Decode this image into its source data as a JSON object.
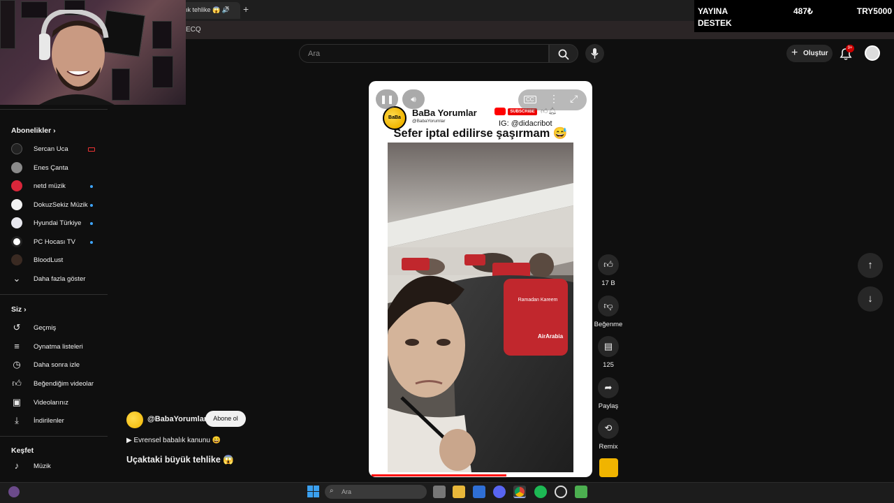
{
  "browser": {
    "tab_title": "ık tehlike 😱 🔊",
    "tab_close": "×",
    "new_tab": "+",
    "url_fragment": "ECQ"
  },
  "donation": {
    "line1": "YAYINA",
    "line2": "DESTEK",
    "amount": "487₺",
    "currency": "TRY5000"
  },
  "header": {
    "search_placeholder": "Ara",
    "create_label": "Oluştur",
    "notification_count": "9+"
  },
  "sidebar": {
    "subscriptions_title": "Abonelikler",
    "subscriptions": [
      {
        "label": "Sercan Uca"
      },
      {
        "label": "Enes Çanta"
      },
      {
        "label": "netd müzik"
      },
      {
        "label": "DokuzSekiz Müzik"
      },
      {
        "label": "Hyundai Türkiye"
      },
      {
        "label": "PC Hocası TV"
      },
      {
        "label": "BloodLust"
      }
    ],
    "show_more": "Daha fazla göster",
    "you_title": "Siz",
    "you_items": [
      {
        "label": "Geçmiş"
      },
      {
        "label": "Oynatma listeleri"
      },
      {
        "label": "Daha sonra izle"
      },
      {
        "label": "Beğendiğim videolar"
      },
      {
        "label": "Videolarınız"
      },
      {
        "label": "İndirilenler"
      }
    ],
    "explore_title": "Keşfet",
    "explore_items": [
      {
        "label": "Müzik"
      }
    ]
  },
  "short": {
    "channel_name": "BaBa Yorumlar",
    "channel_handle_small": "@BabaYorumlar",
    "subscribe_tag": "SUBSCRIBE",
    "instagram": "IG: @didacribot",
    "overlay_title": "Sefer iptal edilirse şaşırmam 😅",
    "seat_text": "Ramadan Kareem",
    "seat_brand": "AirArabia",
    "cc_label": "CC",
    "progress": 0.62
  },
  "actions": {
    "likes": "17 B",
    "dislike": "Beğenme",
    "comments": "125",
    "share": "Paylaş",
    "remix": "Remix"
  },
  "info": {
    "handle": "@BabaYorumlar",
    "subscribe": "Abone ol",
    "music": "▶ Evrensel babalık kanunu 😄",
    "title": "Uçaktaki büyük tehlike 😱"
  },
  "taskbar": {
    "search_placeholder": "Ara"
  },
  "colors": {
    "background": "#0f0f0f",
    "accent_red": "#ff0000",
    "subscribe_bg": "#f1f1f1"
  }
}
